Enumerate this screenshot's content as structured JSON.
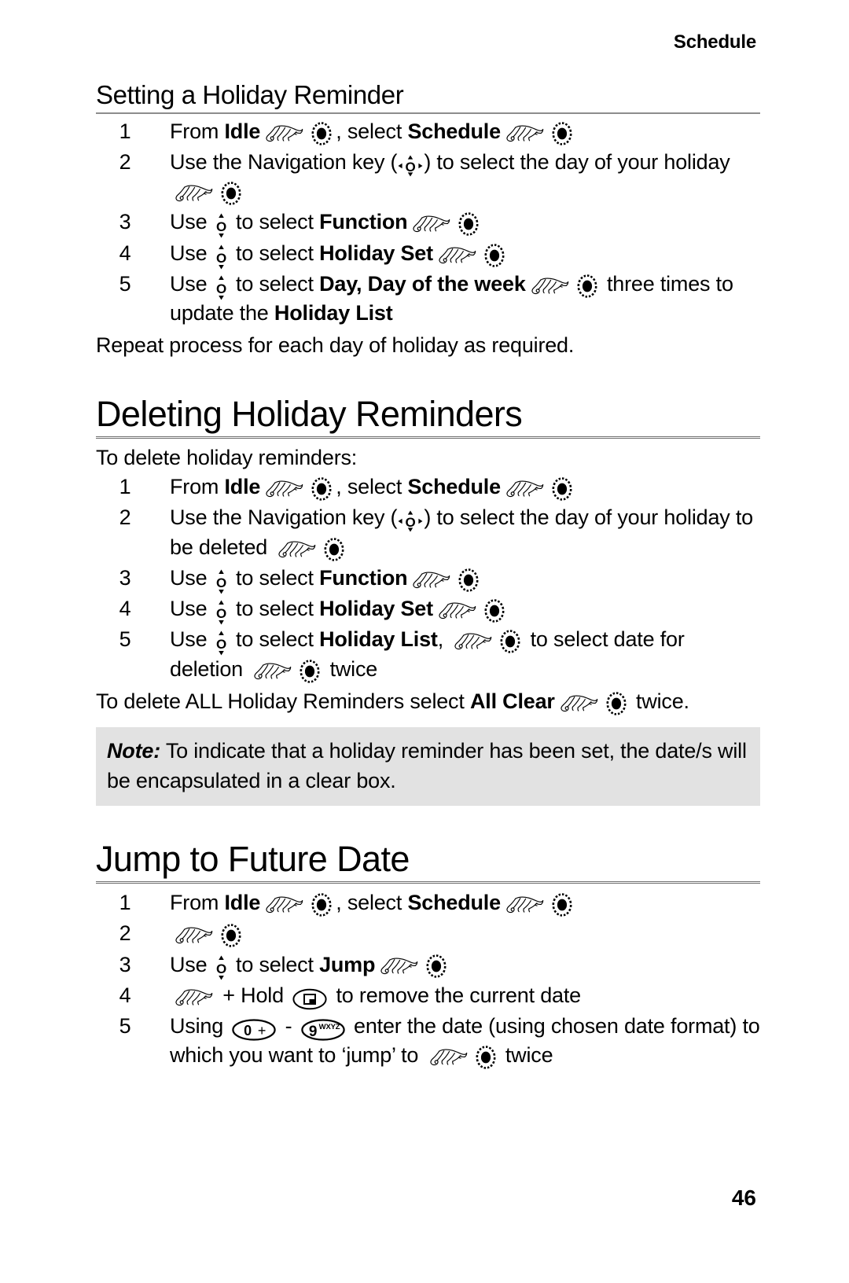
{
  "document": {
    "running_header": "Schedule",
    "page_number": "46"
  },
  "sections": [
    {
      "id": "setting-holiday-reminder",
      "heading": "Setting a Holiday Reminder",
      "heading_level": "sub",
      "steps": [
        {
          "num": "1",
          "parts": [
            {
              "t": "text",
              "v": "From "
            },
            {
              "t": "bold",
              "v": "Idle"
            },
            {
              "t": "icon",
              "v": "hand-pointer-icon"
            },
            {
              "t": "icon",
              "v": "select-key-icon"
            },
            {
              "t": "text",
              "v": ", select "
            },
            {
              "t": "bold",
              "v": "Schedule"
            },
            {
              "t": "icon",
              "v": "hand-pointer-icon"
            },
            {
              "t": "icon",
              "v": "select-key-icon"
            }
          ]
        },
        {
          "num": "2",
          "parts": [
            {
              "t": "text",
              "v": "Use the Navigation key ("
            },
            {
              "t": "icon",
              "v": "navigation-4way-key-icon"
            },
            {
              "t": "text",
              "v": ") to select the day of your holiday "
            },
            {
              "t": "icon",
              "v": "hand-pointer-icon"
            },
            {
              "t": "icon",
              "v": "select-key-icon"
            }
          ]
        },
        {
          "num": "3",
          "parts": [
            {
              "t": "text",
              "v": "Use "
            },
            {
              "t": "icon",
              "v": "navigation-updown-key-icon"
            },
            {
              "t": "text",
              "v": " to select "
            },
            {
              "t": "bold",
              "v": "Function"
            },
            {
              "t": "icon",
              "v": "hand-pointer-icon"
            },
            {
              "t": "icon",
              "v": "select-key-icon"
            }
          ]
        },
        {
          "num": "4",
          "parts": [
            {
              "t": "text",
              "v": "Use "
            },
            {
              "t": "icon",
              "v": "navigation-updown-key-icon"
            },
            {
              "t": "text",
              "v": " to select "
            },
            {
              "t": "bold",
              "v": "Holiday Set"
            },
            {
              "t": "icon",
              "v": "hand-pointer-icon"
            },
            {
              "t": "icon",
              "v": "select-key-icon"
            }
          ]
        },
        {
          "num": "5",
          "parts": [
            {
              "t": "text",
              "v": "Use "
            },
            {
              "t": "icon",
              "v": "navigation-updown-key-icon"
            },
            {
              "t": "text",
              "v": " to select "
            },
            {
              "t": "bold",
              "v": "Day, Day of the week"
            },
            {
              "t": "icon",
              "v": "hand-pointer-icon"
            },
            {
              "t": "icon",
              "v": "select-key-icon"
            },
            {
              "t": "text",
              "v": " three times to update the "
            },
            {
              "t": "bold",
              "v": "Holiday List"
            }
          ]
        }
      ],
      "closing_paragraph": "Repeat process for each day of holiday as required."
    },
    {
      "id": "deleting-holiday-reminders",
      "heading": "Deleting Holiday Reminders",
      "heading_level": "main",
      "intro_paragraph": "To delete holiday reminders:",
      "steps": [
        {
          "num": "1",
          "parts": [
            {
              "t": "text",
              "v": "From "
            },
            {
              "t": "bold",
              "v": "Idle"
            },
            {
              "t": "icon",
              "v": "hand-pointer-icon"
            },
            {
              "t": "icon",
              "v": "select-key-icon"
            },
            {
              "t": "text",
              "v": ", select "
            },
            {
              "t": "bold",
              "v": "Schedule"
            },
            {
              "t": "icon",
              "v": "hand-pointer-icon"
            },
            {
              "t": "icon",
              "v": "select-key-icon"
            }
          ]
        },
        {
          "num": "2",
          "parts": [
            {
              "t": "text",
              "v": "Use the Navigation key ("
            },
            {
              "t": "icon",
              "v": "navigation-4way-key-icon"
            },
            {
              "t": "text",
              "v": ") to select the day of your holiday to be deleted "
            },
            {
              "t": "icon",
              "v": "hand-pointer-icon"
            },
            {
              "t": "icon",
              "v": "select-key-icon"
            }
          ]
        },
        {
          "num": "3",
          "parts": [
            {
              "t": "text",
              "v": "Use "
            },
            {
              "t": "icon",
              "v": "navigation-updown-key-icon"
            },
            {
              "t": "text",
              "v": " to select "
            },
            {
              "t": "bold",
              "v": "Function"
            },
            {
              "t": "icon",
              "v": "hand-pointer-icon"
            },
            {
              "t": "icon",
              "v": "select-key-icon"
            }
          ]
        },
        {
          "num": "4",
          "parts": [
            {
              "t": "text",
              "v": "Use "
            },
            {
              "t": "icon",
              "v": "navigation-updown-key-icon"
            },
            {
              "t": "text",
              "v": " to select "
            },
            {
              "t": "bold",
              "v": "Holiday Set"
            },
            {
              "t": "icon",
              "v": "hand-pointer-icon"
            },
            {
              "t": "icon",
              "v": "select-key-icon"
            }
          ]
        },
        {
          "num": "5",
          "parts": [
            {
              "t": "text",
              "v": "Use "
            },
            {
              "t": "icon",
              "v": "navigation-updown-key-icon"
            },
            {
              "t": "text",
              "v": " to select "
            },
            {
              "t": "bold",
              "v": "Holiday List"
            },
            {
              "t": "text",
              "v": ", "
            },
            {
              "t": "icon",
              "v": "hand-pointer-icon"
            },
            {
              "t": "icon",
              "v": "select-key-icon"
            },
            {
              "t": "text",
              "v": " to select date for deletion "
            },
            {
              "t": "icon",
              "v": "hand-pointer-icon"
            },
            {
              "t": "icon",
              "v": "select-key-icon"
            },
            {
              "t": "text",
              "v": " twice"
            }
          ]
        }
      ],
      "closing_parts": [
        {
          "t": "text",
          "v": "To delete ALL Holiday Reminders select "
        },
        {
          "t": "bold",
          "v": "All Clear"
        },
        {
          "t": "icon",
          "v": "hand-pointer-icon"
        },
        {
          "t": "icon",
          "v": "select-key-icon"
        },
        {
          "t": "text",
          "v": " twice."
        }
      ],
      "note": {
        "label": "Note:",
        "text": " To indicate that a holiday reminder has been set, the date/s will be encapsulated in a clear box."
      }
    },
    {
      "id": "jump-to-future-date",
      "heading": "Jump to Future Date",
      "heading_level": "main",
      "steps": [
        {
          "num": "1",
          "parts": [
            {
              "t": "text",
              "v": "From "
            },
            {
              "t": "bold",
              "v": "Idle"
            },
            {
              "t": "icon",
              "v": "hand-pointer-icon"
            },
            {
              "t": "icon",
              "v": "select-key-icon"
            },
            {
              "t": "text",
              "v": ", select "
            },
            {
              "t": "bold",
              "v": "Schedule"
            },
            {
              "t": "icon",
              "v": "hand-pointer-icon"
            },
            {
              "t": "icon",
              "v": "select-key-icon"
            }
          ]
        },
        {
          "num": "2",
          "parts": [
            {
              "t": "icon",
              "v": "hand-pointer-icon"
            },
            {
              "t": "icon",
              "v": "select-key-icon"
            }
          ]
        },
        {
          "num": "3",
          "parts": [
            {
              "t": "text",
              "v": "Use "
            },
            {
              "t": "icon",
              "v": "navigation-updown-key-icon"
            },
            {
              "t": "text",
              "v": " to select "
            },
            {
              "t": "bold",
              "v": "Jump"
            },
            {
              "t": "icon",
              "v": "hand-pointer-icon"
            },
            {
              "t": "icon",
              "v": "select-key-icon"
            }
          ]
        },
        {
          "num": "4",
          "parts": [
            {
              "t": "icon",
              "v": "hand-pointer-icon"
            },
            {
              "t": "text",
              "v": " + Hold "
            },
            {
              "t": "icon",
              "v": "clear-key-icon"
            },
            {
              "t": "text",
              "v": " to remove the current date"
            }
          ]
        },
        {
          "num": "5",
          "parts": [
            {
              "t": "text",
              "v": "Using "
            },
            {
              "t": "icon",
              "v": "key-0-plus-icon"
            },
            {
              "t": "text",
              "v": " - "
            },
            {
              "t": "icon",
              "v": "key-9-wxyz-icon"
            },
            {
              "t": "text",
              "v": " enter the date (using chosen date format) to which  you want to ‘jump’ to "
            },
            {
              "t": "icon",
              "v": "hand-pointer-icon"
            },
            {
              "t": "icon",
              "v": "select-key-icon"
            },
            {
              "t": "text",
              "v": " twice"
            }
          ]
        }
      ]
    }
  ],
  "icon_labels": {
    "hand-pointer-icon": "pointing hand",
    "select-key-icon": "select / OK key",
    "navigation-4way-key-icon": "four-way navigation key",
    "navigation-updown-key-icon": "up-down navigation key",
    "clear-key-icon": "clear key",
    "key-0-plus-icon": "0 +",
    "key-9-wxyz-icon": "9 WXYZ"
  },
  "colors": {
    "text": "#000000",
    "page_background": "#ffffff",
    "note_background": "#e2e2e2",
    "rule": "#8d8d8d"
  }
}
